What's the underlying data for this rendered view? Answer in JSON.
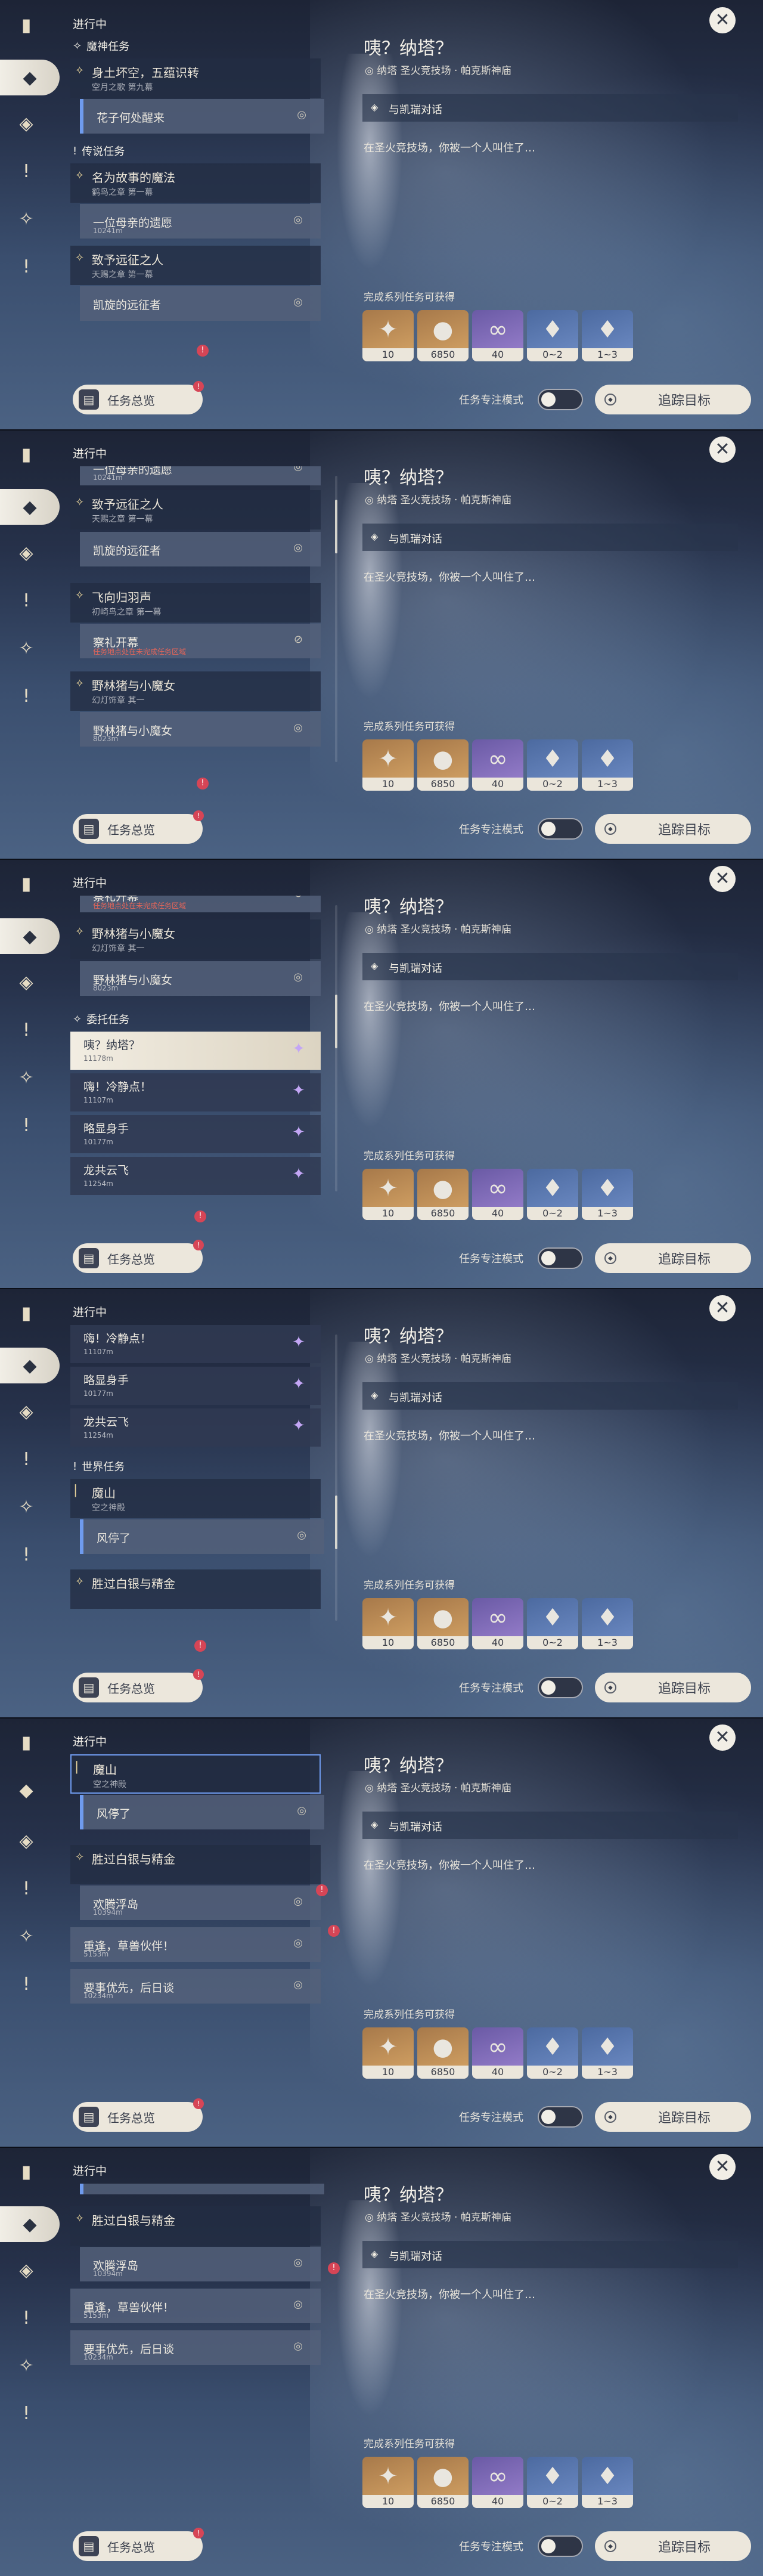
{
  "rail": {
    "icons": [
      "quest-book-icon",
      "all-quests-icon",
      "archon-quest-icon",
      "important-quest-icon",
      "commission-icon",
      "world-quest-icon"
    ]
  },
  "in_progress": "进行中",
  "detail": {
    "title": "咦？纳塔？",
    "location": "纳塔 圣火竞技场 · 帕克斯神庙",
    "objective": "与凯瑞对话",
    "description": "在圣火竞技场，你被一个人叫住了…",
    "rewards_label": "完成系列任务可获得",
    "rewards": [
      {
        "name": "primogem",
        "count": "10",
        "color": "#d6a566",
        "glyph": "✦"
      },
      {
        "name": "mora",
        "count": "6850",
        "color": "#d6a566",
        "glyph": "●"
      },
      {
        "name": "adventure-exp",
        "count": "40",
        "color": "#9b82cf",
        "glyph": "∞"
      },
      {
        "name": "crystal-a",
        "count": "0~2",
        "color": "#6f8dc6",
        "glyph": "♦"
      },
      {
        "name": "crystal-b",
        "count": "1~3",
        "color": "#6f8dc6",
        "glyph": "♦"
      }
    ]
  },
  "bottom": {
    "overview": "任务总览",
    "focus_mode": "任务专注模式",
    "track": "追踪目标",
    "badge": "!"
  },
  "quests": {
    "cat_archon": "魔神任务",
    "q1_title": "身土坏空，五蕴识转",
    "q1_sub": "空月之歌 第九幕",
    "q1_step": "花子何处醒来",
    "cat_legend": "传说任务",
    "q2_title": "名为故事的魔法",
    "q2_sub": "鹤鸟之章 第一幕",
    "q2_step": "一位母亲的遗愿",
    "q2_dist": "10241m",
    "q3_title": "致予远征之人",
    "q3_sub": "天赐之章 第一幕",
    "q3_step": "凯旋的远征者",
    "q4_title": "飞向归羽声",
    "q4_sub": "初崎鸟之章 第一幕",
    "q4_step": "察礼开幕",
    "q4_warn": "任务地点处在未完成任务区域",
    "q5_title": "野林猪与小魔女",
    "q5_sub": "幻灯饰章 其一",
    "q5_step": "野林猪与小魔女",
    "q5_dist": "8023m",
    "cat_comm": "委托任务",
    "c1_title": "咦？纳塔？",
    "c1_dist": "11178m",
    "c2_title": "嗨！冷静点！",
    "c2_dist": "11107m",
    "c3_title": "略显身手",
    "c3_dist": "10177m",
    "c4_title": "龙共云飞",
    "c4_dist": "11254m",
    "cat_world": "世界任务",
    "w1_title": "魔山",
    "w1_sub": "空之神殿",
    "w1_step": "风停了",
    "w2_title": "胜过白银与精金",
    "w2_step": "欢腾浮岛",
    "w2_dist": "10394m",
    "w3_title": "重逢，草兽伙伴！",
    "w3_dist": "5153m",
    "w4_title": "要事优先，后日谈",
    "w4_dist": "10234m"
  }
}
